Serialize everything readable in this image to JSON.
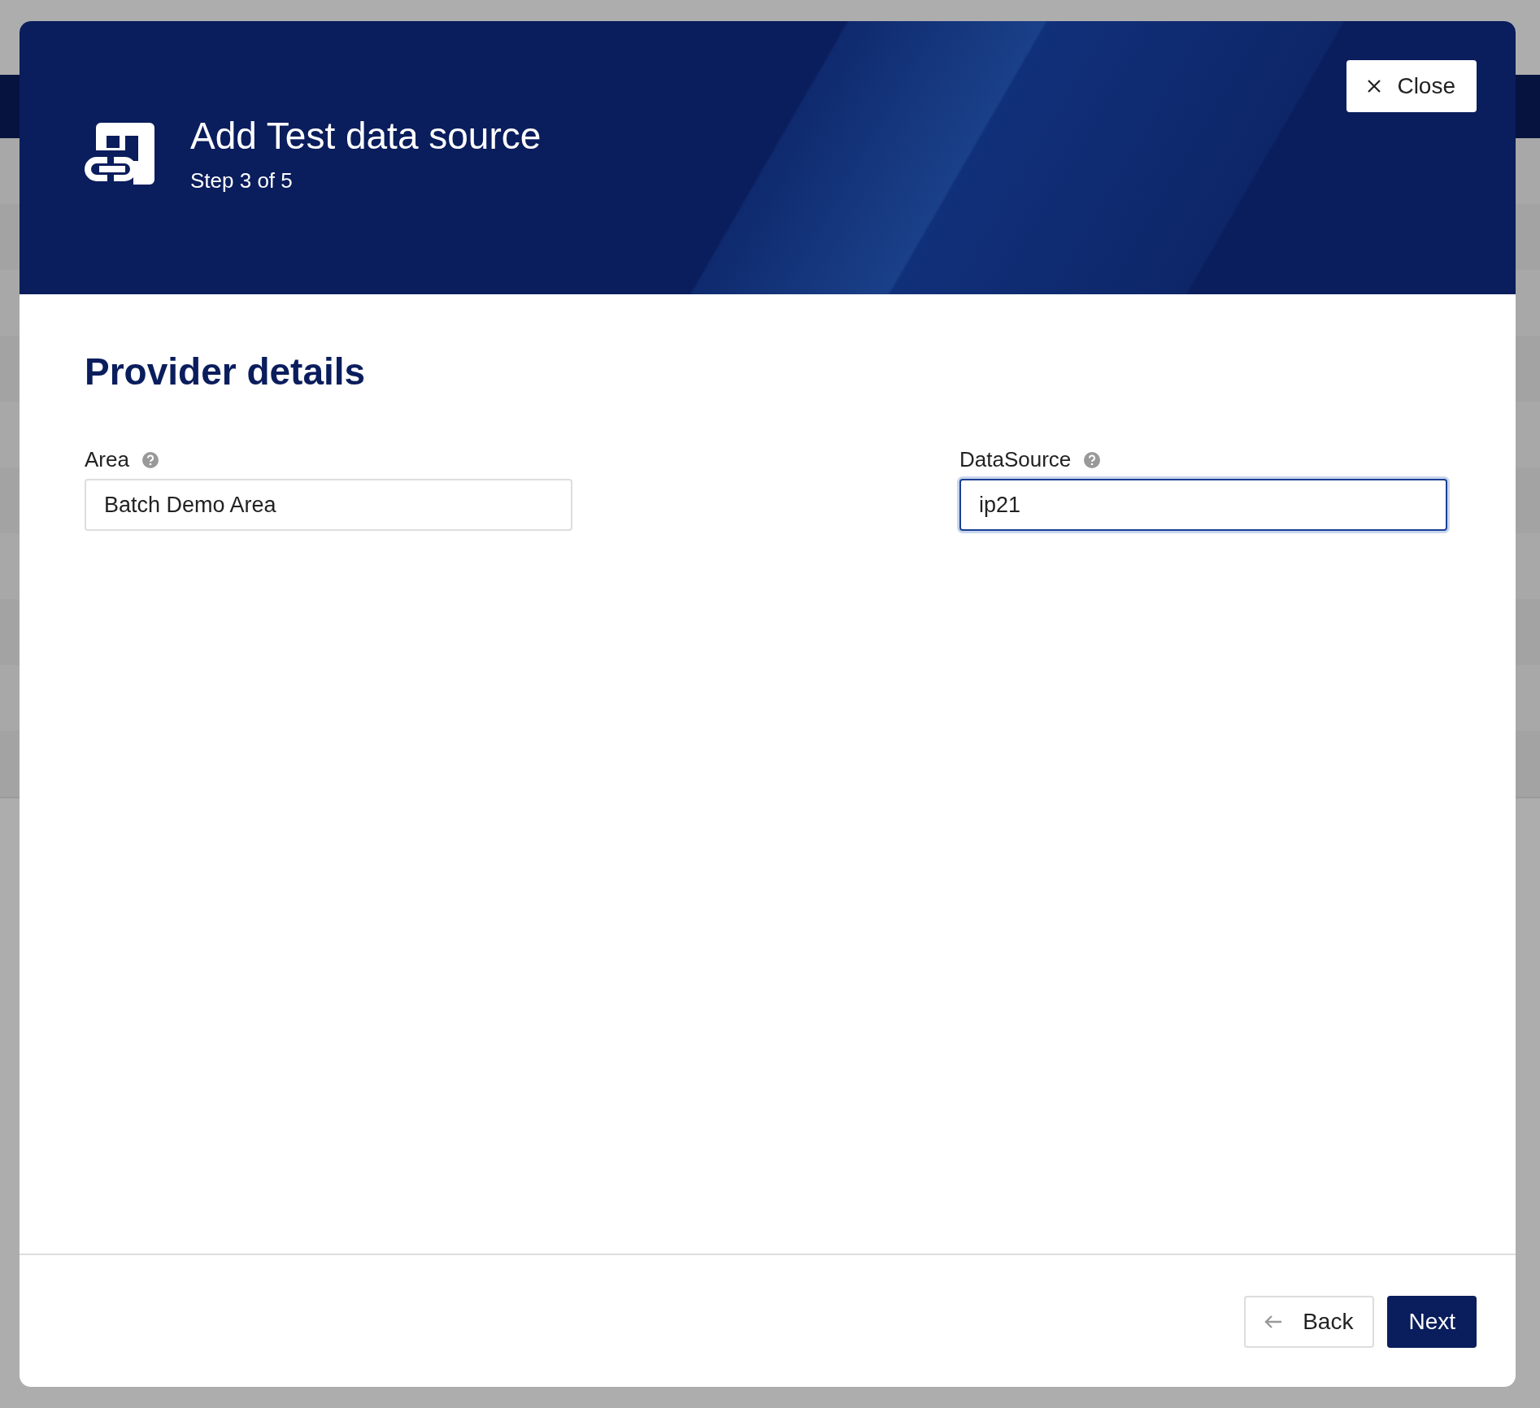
{
  "dialog": {
    "title": "Add Test data source",
    "step": "Step 3 of 5",
    "close_button": "Close"
  },
  "section": {
    "heading": "Provider details"
  },
  "fields": [
    {
      "label": "Area",
      "value": "Batch Demo Area",
      "focused": false
    },
    {
      "label": "DataSource",
      "value": "ip21",
      "focused": true
    }
  ],
  "footer": {
    "back_button": "Back",
    "next_button": "Next"
  }
}
